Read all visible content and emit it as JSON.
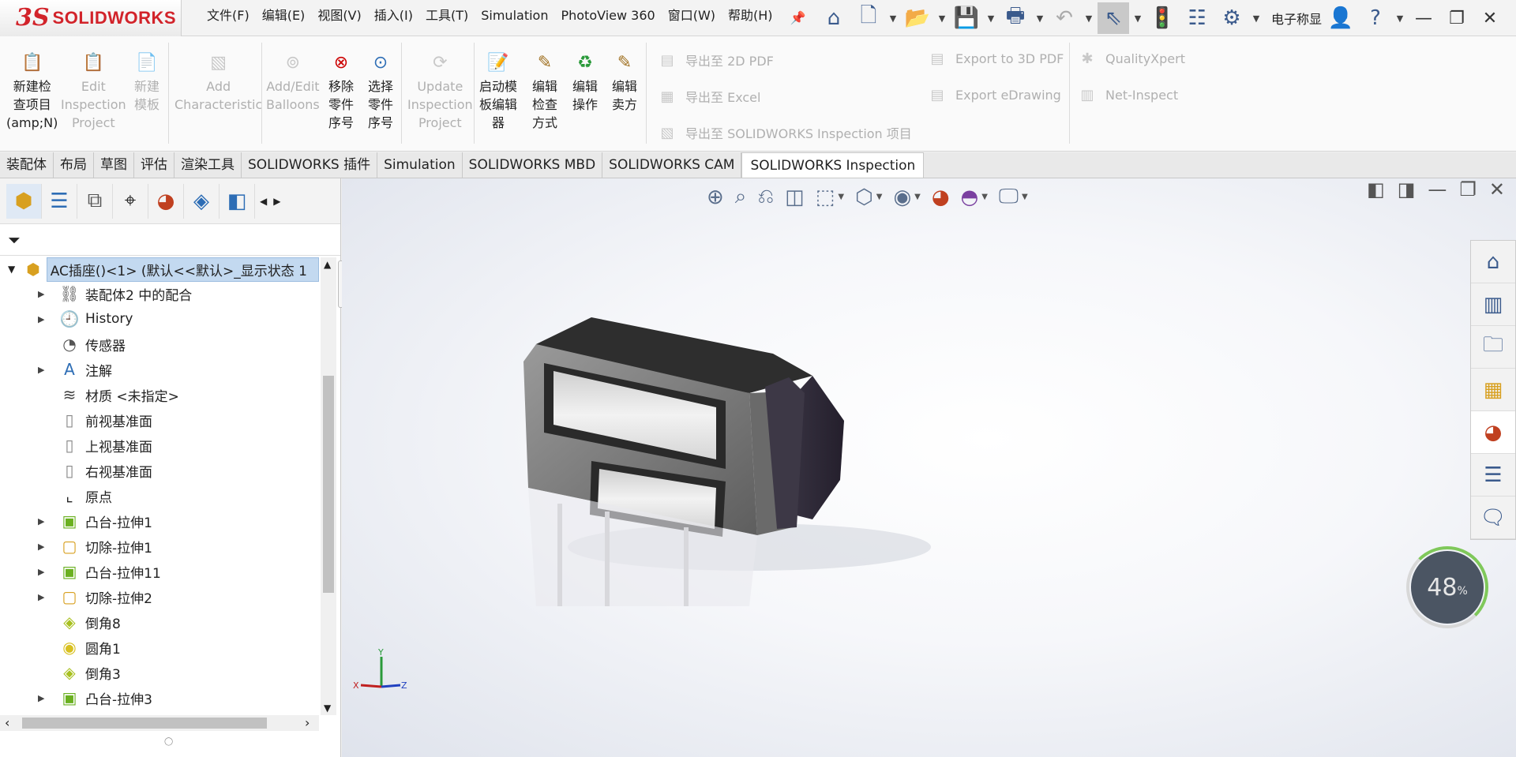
{
  "app": {
    "brand_ds": "3S",
    "brand": "SOLIDWORKS"
  },
  "menu": [
    "文件(F)",
    "编辑(E)",
    "视图(V)",
    "插入(I)",
    "工具(T)",
    "Simulation",
    "PhotoView 360",
    "窗口(W)",
    "帮助(H)"
  ],
  "user_label": "电子称显",
  "ribbon": {
    "new_project": [
      "新建检",
      "查项目",
      "(amp;N)"
    ],
    "edit_project": [
      "Edit",
      "Inspection",
      "Project"
    ],
    "new_template": [
      "新建",
      "模板"
    ],
    "add_characteristic": [
      "Add",
      "Characteristic"
    ],
    "add_edit_balloons": [
      "Add/Edit",
      "Balloons"
    ],
    "remove_part_numbers": [
      "移除",
      "零件",
      "序号"
    ],
    "select_part_numbers": [
      "选择",
      "零件",
      "序号"
    ],
    "update_project": [
      "Update",
      "Inspection",
      "Project"
    ],
    "launch_template_editor": [
      "启动模",
      "板编辑",
      "器"
    ],
    "edit_inspection_method": [
      "编辑",
      "检查",
      "方式"
    ],
    "edit_operation": [
      "编辑",
      "操作"
    ],
    "edit_vendor": [
      "编辑",
      "卖方"
    ],
    "export_2d_pdf": "导出至 2D PDF",
    "export_excel": "导出至 Excel",
    "export_sw_inspection": "导出至 SOLIDWORKS Inspection 项目",
    "export_3d_pdf": "Export to 3D PDF",
    "export_edrawing": "Export eDrawing",
    "quality_xpert": "QualityXpert",
    "net_inspect": "Net-Inspect"
  },
  "tabs": [
    "装配体",
    "布局",
    "草图",
    "评估",
    "渲染工具",
    "SOLIDWORKS 插件",
    "Simulation",
    "SOLIDWORKS MBD",
    "SOLIDWORKS CAM",
    "SOLIDWORKS Inspection"
  ],
  "active_tab": "SOLIDWORKS Inspection",
  "tree": {
    "root": "AC插座()<1> (默认<<默认>_显示状态 1",
    "items": [
      {
        "label": "装配体2 中的配合",
        "icon": "mates-icon",
        "expandable": true
      },
      {
        "label": "History",
        "icon": "history-icon",
        "expandable": true
      },
      {
        "label": "传感器",
        "icon": "sensor-icon",
        "expandable": false
      },
      {
        "label": "注解",
        "icon": "annotation-icon",
        "expandable": true
      },
      {
        "label": "材质 <未指定>",
        "icon": "material-icon",
        "expandable": false
      },
      {
        "label": "前视基准面",
        "icon": "plane-icon",
        "expandable": false
      },
      {
        "label": "上视基准面",
        "icon": "plane-icon",
        "expandable": false
      },
      {
        "label": "右视基准面",
        "icon": "plane-icon",
        "expandable": false
      },
      {
        "label": "原点",
        "icon": "origin-icon",
        "expandable": false
      },
      {
        "label": "凸台-拉伸1",
        "icon": "boss-extrude-icon",
        "expandable": true
      },
      {
        "label": "切除-拉伸1",
        "icon": "cut-extrude-icon",
        "expandable": true
      },
      {
        "label": "凸台-拉伸11",
        "icon": "boss-extrude-icon",
        "expandable": true
      },
      {
        "label": "切除-拉伸2",
        "icon": "cut-extrude-icon",
        "expandable": true
      },
      {
        "label": "倒角8",
        "icon": "chamfer-icon",
        "expandable": false
      },
      {
        "label": "圆角1",
        "icon": "fillet-icon",
        "expandable": false
      },
      {
        "label": "倒角3",
        "icon": "chamfer-icon",
        "expandable": false
      },
      {
        "label": "凸台-拉伸3",
        "icon": "boss-extrude-icon",
        "expandable": true
      }
    ]
  },
  "gauge": {
    "value": "48",
    "unit": "%"
  },
  "triad": {
    "x": "X",
    "y": "Y",
    "z": "Z"
  },
  "colors": {
    "brand_red": "#d2232a",
    "selection": "#c3d9f0",
    "accent_green": "#7fc85a"
  }
}
